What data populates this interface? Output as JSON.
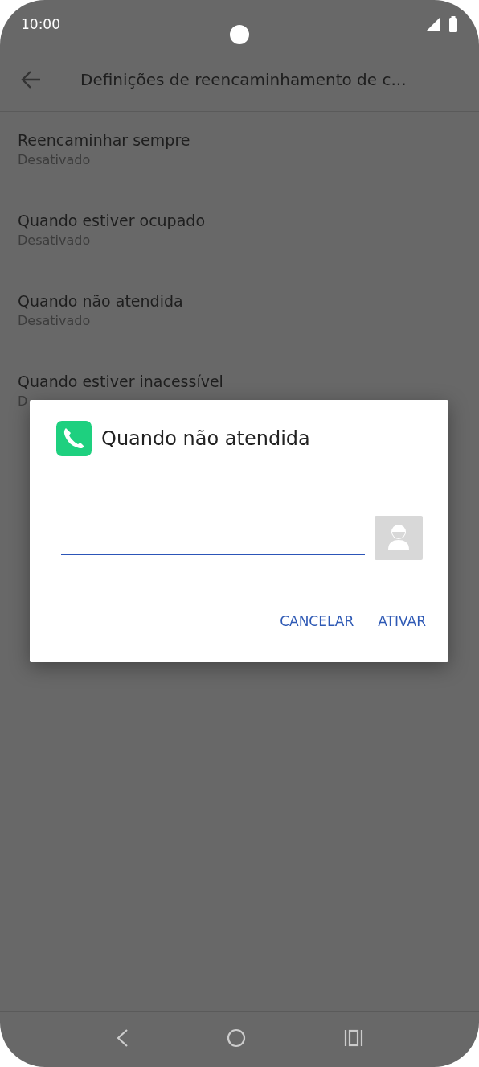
{
  "status_bar": {
    "time": "10:00"
  },
  "toolbar": {
    "title": "Definições de reencaminhamento de c..."
  },
  "settings": [
    {
      "title": "Reencaminhar sempre",
      "subtitle": "Desativado"
    },
    {
      "title": "Quando estiver ocupado",
      "subtitle": "Desativado"
    },
    {
      "title": "Quando não atendida",
      "subtitle": "Desativado"
    },
    {
      "title": "Quando estiver inacessível",
      "subtitle": "D"
    }
  ],
  "dialog": {
    "title": "Quando não atendida",
    "buttons": [
      "CANCELAR",
      "ATIVAR"
    ]
  }
}
